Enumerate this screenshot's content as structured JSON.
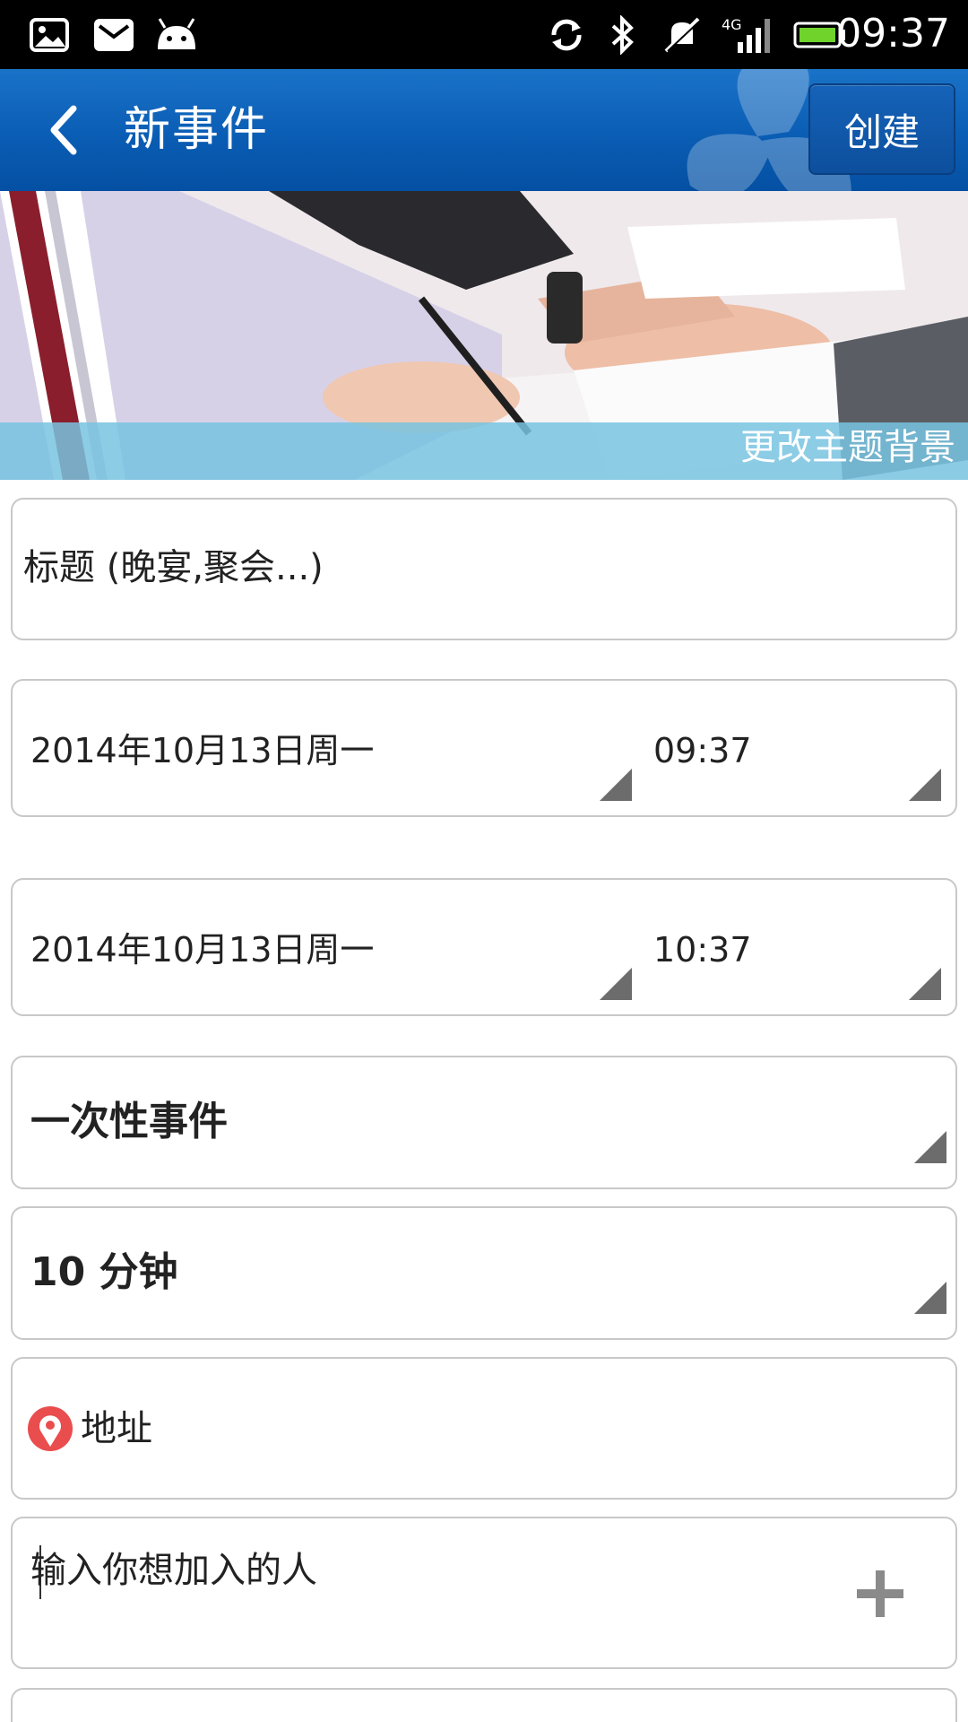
{
  "status_bar": {
    "time": "09:37",
    "icons": [
      "gallery-icon",
      "mail-icon",
      "android-icon",
      "sync-icon",
      "bluetooth-icon",
      "mute-icon",
      "signal-4g-icon",
      "battery-icon"
    ]
  },
  "app_bar": {
    "title": "新事件",
    "create_label": "创建",
    "accent_color": "#0a5db4"
  },
  "banner": {
    "change_theme_label": "更改主题背景"
  },
  "form": {
    "title_placeholder": "标题 (晚宴,聚会...)",
    "start": {
      "date": "2014年10月13日周一",
      "time": "09:37"
    },
    "end": {
      "date": "2014年10月13日周一",
      "time": "10:37"
    },
    "repeat": "一次性事件",
    "reminder": "10 分钟",
    "address_placeholder": "地址",
    "invitees_placeholder": "输入你想加入的人"
  }
}
